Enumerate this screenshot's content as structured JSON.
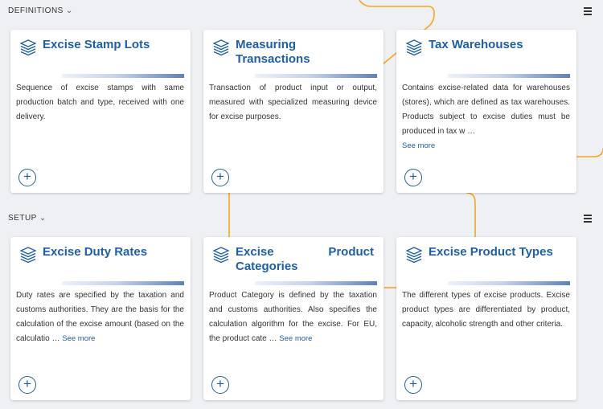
{
  "sections": [
    {
      "label": "DEFINITIONS",
      "cards": [
        {
          "title": "Excise Stamp Lots",
          "description": "Sequence of excise stamps with same production batch and type, received with one delivery.",
          "see_more": ""
        },
        {
          "title": "Measuring Transactions",
          "description": "Transaction of product input or output, measured with specialized measuring device for excise purposes.",
          "see_more": ""
        },
        {
          "title": "Tax Warehouses",
          "description": "Contains excise-related data for warehouses (stores), which are defined as tax warehouses. Products subject to excise duties must be produced in tax w …",
          "see_more": "See more"
        }
      ]
    },
    {
      "label": "SETUP",
      "cards": [
        {
          "title": "Excise Duty Rates",
          "description": "Duty rates are specified by the taxation and customs authorities. They are the basis for the calculation of the excise amount (based on the calculatio …",
          "see_more": "See more"
        },
        {
          "title": "Excise Product Categories",
          "description": "Product Category is defined by the taxation and customs authorities. Also specifies the calculation algorithm for the excise. For EU, the product cate …",
          "see_more": "See more"
        },
        {
          "title": "Excise Product Types",
          "description": "The different types of excise products. Excise product types are differentiated by product, capacity, alcoholic strength and other criteria.",
          "see_more": ""
        }
      ]
    }
  ],
  "add_label": "+",
  "icons": {
    "card": "layers-icon",
    "menu": "hamburger-menu-icon",
    "chevron": "chevron-down-icon",
    "add": "plus-circle-icon"
  },
  "colors": {
    "accent": "#1f5fa6",
    "connector": "#f5a623",
    "background": "#eef0f4"
  }
}
